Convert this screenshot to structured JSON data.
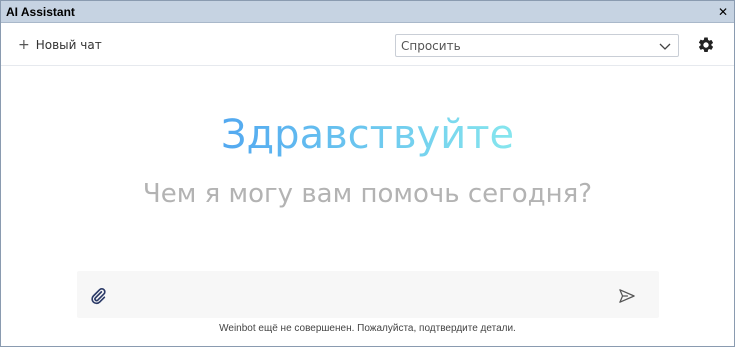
{
  "window": {
    "title": "AI Assistant",
    "close_glyph": "✕",
    "close_icon": "close-icon"
  },
  "toolbar": {
    "new_chat_icon": "plus-icon",
    "new_chat_label": "Новый чат",
    "mode_select_value": "Спросить",
    "mode_select_icon": "chevron-down-icon",
    "settings_icon": "gear-icon"
  },
  "main": {
    "greeting": "Здравствуйте",
    "subtitle": "Чем я могу вам помочь сегодня?"
  },
  "composer": {
    "attach_icon": "paperclip-icon",
    "input_value": "",
    "send_icon": "send-icon"
  },
  "footer": {
    "disclaimer": "Weinbot ещё не совершенен. Пожалуйста, подтвердите детали."
  },
  "colors": {
    "titlebar_bg": "#c6d3e2",
    "greeting_gradient_start": "#52a8f0",
    "greeting_gradient_end": "#86e6ee",
    "subtitle": "#b3b3b3",
    "composer_bg": "#f7f7f7"
  }
}
